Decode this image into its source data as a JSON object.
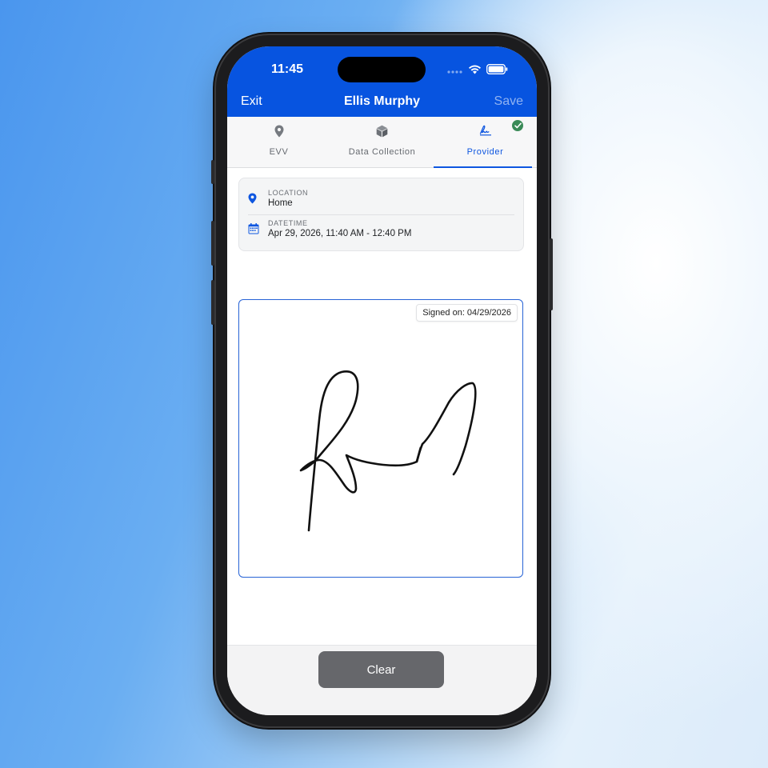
{
  "status_bar": {
    "time": "11:45"
  },
  "header": {
    "exit_label": "Exit",
    "title": "Ellis Murphy",
    "save_label": "Save"
  },
  "tabs": [
    {
      "label": "EVV",
      "icon": "location-pin-icon",
      "active": false
    },
    {
      "label": "Data Collection",
      "icon": "cube-icon",
      "active": false
    },
    {
      "label": "Provider",
      "icon": "signature-icon",
      "active": true,
      "completed": true
    }
  ],
  "visit_info": {
    "location_label": "LOCATION",
    "location_value": "Home",
    "datetime_label": "DATETIME",
    "datetime_value": "Apr 29, 2026, 11:40 AM - 12:40 PM"
  },
  "signature": {
    "signed_text": "Signed on: 04/29/2026"
  },
  "footer": {
    "clear_label": "Clear"
  },
  "colors": {
    "primary": "#0754e0",
    "accent_blue": "#0e56e0",
    "success": "#3a8a57",
    "button_gray": "#66676b"
  }
}
